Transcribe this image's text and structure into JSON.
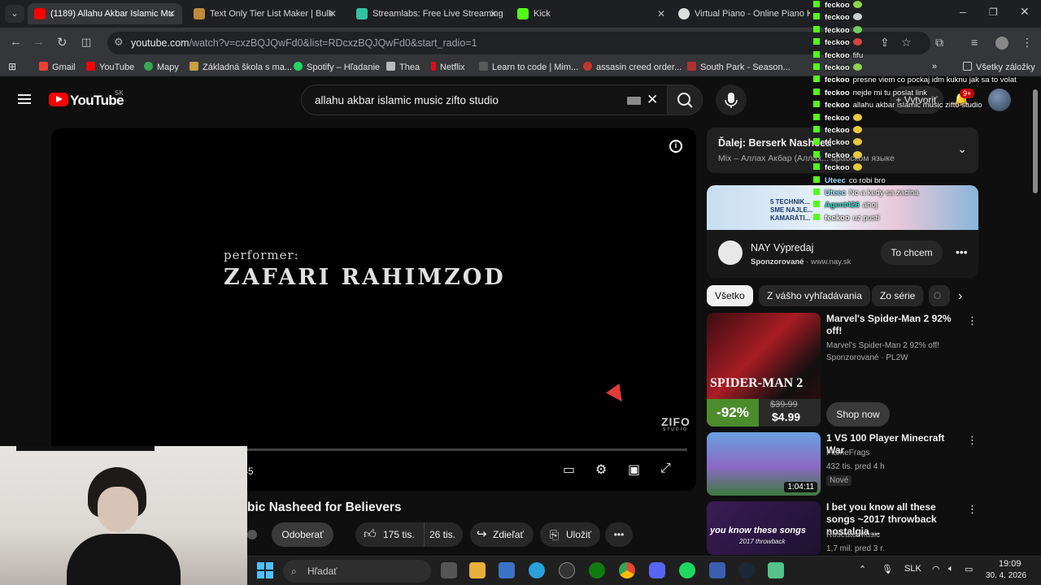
{
  "browser": {
    "tabs": [
      {
        "title": "(1189) Allahu Akbar Islamic Mu",
        "active": true,
        "color": "#ff0000"
      },
      {
        "title": "Text Only Tier List Maker | Bulk",
        "active": false,
        "color": "#c08a3a"
      },
      {
        "title": "Streamlabs: Free Live Streaming",
        "active": false,
        "color": "#31c3a2"
      },
      {
        "title": "Kick",
        "active": false,
        "color": "#53fc18"
      },
      {
        "title": "Virtual Piano - Online Piano Key",
        "active": false,
        "color": "#dddddd"
      }
    ],
    "url_host": "youtube.com",
    "url_path": "/watch?v=cxzBQJQwFd0&list=RDcxzBQJQwFd0&start_radio=1",
    "bookmarks": [
      {
        "label": "Gmail",
        "color": "#ea4335"
      },
      {
        "label": "YouTube",
        "color": "#ff0000"
      },
      {
        "label": "Mapy",
        "color": "#34a853"
      },
      {
        "label": "Základná škola s ma...",
        "color": "#c8a040"
      },
      {
        "label": "Spotify – Hľadanie",
        "color": "#1ed760"
      },
      {
        "label": "Thea",
        "color": "#bbbbbb"
      },
      {
        "label": "Netflix",
        "color": "#e50914"
      },
      {
        "label": "Learn to code | Mim...",
        "color": "#5a5a5a"
      },
      {
        "label": "assasin creed order...",
        "color": "#c0392b"
      },
      {
        "label": "South Park - Season...",
        "color": "#b03030"
      }
    ],
    "all_bookmarks": "Všetky záložky"
  },
  "youtube": {
    "logo_text": "YouTube",
    "region": "SK",
    "search_query": "allahu akbar islamic music zifto studio",
    "create_label": "+ Vytvoriť",
    "notif_count": "9+"
  },
  "player": {
    "performer_label": "performer:",
    "artist": "ZAFARI RAHIMZOD",
    "watermark": "ZIFO",
    "watermark_sub": "STUDIO",
    "time": ":45",
    "progress": 0.0
  },
  "video": {
    "title": "bic Nasheed for Believers",
    "subscribe_label": "Odoberať",
    "likes": "175 tis.",
    "dislikes": "26 tis.",
    "share_label": "Zdieľať",
    "save_label": "Uložiť"
  },
  "playlist": {
    "next_label": "Ďalej: Berserk Nasheed",
    "subtitle": "Mix – Аллах Акбар (Аллах... арабском языке"
  },
  "ad": {
    "banner_lines": [
      "5 TECHNIK...",
      "SME NAJLE...",
      "KAMARÁTI..."
    ],
    "name": "NAY Výpredaj",
    "sponsored": "Sponzorované",
    "domain": "www.nay.sk",
    "cta": "To chcem"
  },
  "chips": [
    "Všetko",
    "Z vášho vyhľadávania",
    "Zo série",
    "O"
  ],
  "recommendations": [
    {
      "title": "Marvel's Spider-Man 2 92% off!",
      "sub1": "Marvel's Spider-Man 2 92% off!",
      "sub2": "Sponzorované · PL2W",
      "thumb_title": "SPIDER-MAN 2",
      "discount": "-92%",
      "old_price": "$39.99",
      "price": "$4.99",
      "cta": "Shop now"
    },
    {
      "title": "1 VS 100 Player Minecraft War",
      "channel": "FlameFrags",
      "meta": "432 tis.  pred 4 h",
      "badge": "Nové",
      "duration": "1:04:11"
    },
    {
      "title": "I bet you know all these songs ~2017 throwback nostalgia ...",
      "channel": "Roseate Music",
      "meta": "1,7 mil.  pred 3 r.",
      "thumb_text": "you know these songs",
      "thumb_sub": "2017 throwback"
    }
  ],
  "chat": [
    {
      "user": "feckoo",
      "msg": "",
      "emote": true
    },
    {
      "user": "feckoo",
      "msg": "",
      "emote": true
    },
    {
      "user": "feckoo",
      "msg": "",
      "emote": true
    },
    {
      "user": "feckoo",
      "msg": "",
      "emote": true
    },
    {
      "user": "feckoo",
      "msg": "fifu",
      "emote": false
    },
    {
      "user": "feckoo",
      "msg": "",
      "emote": true
    },
    {
      "user": "feckoo",
      "msg": "presne viem co pockaj idm kuknu jak sa to volat",
      "emote": false
    },
    {
      "user": "feckoo",
      "msg": "nejde mi tu poslat link",
      "emote": false
    },
    {
      "user": "feckoo",
      "msg": "allahu akbar islamic music zifto studio",
      "emote": false
    },
    {
      "user": "feckoo",
      "msg": "",
      "emote": true
    },
    {
      "user": "feckoo",
      "msg": "",
      "emote": true
    },
    {
      "user": "feckoo",
      "msg": "",
      "emote": true
    },
    {
      "user": "feckoo",
      "msg": "",
      "emote": true
    },
    {
      "user": "feckoo",
      "msg": "",
      "emote": true
    },
    {
      "user": "Uteec",
      "msg": "co robi bro",
      "emote": false
    },
    {
      "user": "Uteec",
      "msg": "No a kedy sa zacina",
      "emote": false
    },
    {
      "user": "Agent426",
      "msg": "ahoj",
      "emote": false
    },
    {
      "user": "feckoo",
      "msg": "uz pusti",
      "emote": false
    }
  ],
  "taskbar": {
    "search_placeholder": "Hľadať",
    "lang": "SLK",
    "time": "19:09",
    "date": "30. 4. 2026"
  }
}
